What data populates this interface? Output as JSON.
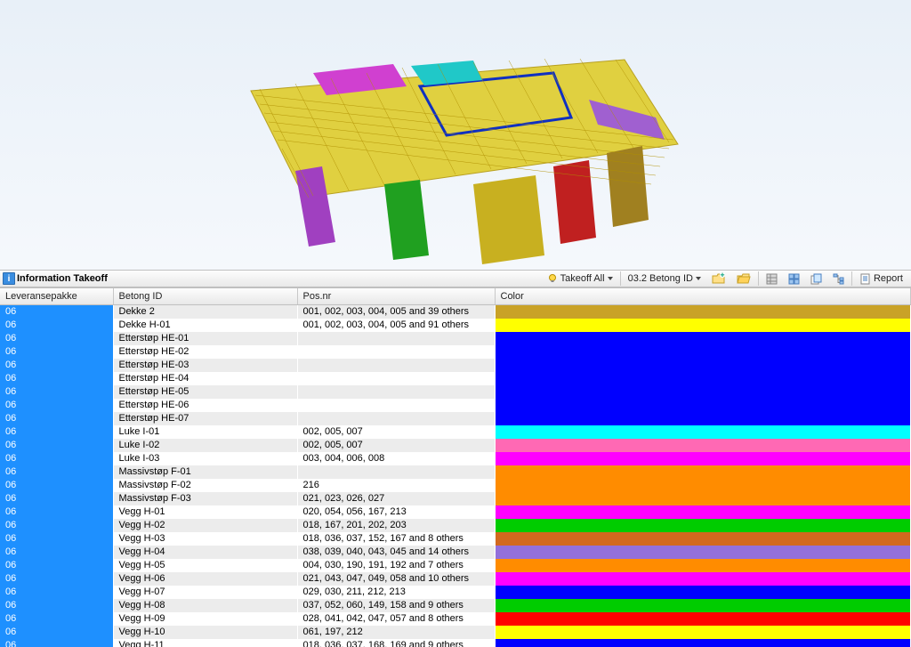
{
  "panel": {
    "title": "Information Takeoff"
  },
  "toolbar": {
    "takeoff_label": "Takeoff All",
    "preset_label": "03.2 Betong ID",
    "report_label": "Report"
  },
  "columns": {
    "c0": "Leveransepakke",
    "c1": "Betong ID",
    "c2": "Pos.nr",
    "c3": "Color"
  },
  "rows": [
    {
      "lp": "06",
      "bid": "Dekke 2",
      "pos": "001, 002, 003, 004, 005 and 39 others",
      "color": "#c9a227"
    },
    {
      "lp": "06",
      "bid": "Dekke H-01",
      "pos": "001, 002, 003, 004, 005 and 91 others",
      "color": "#ffff00"
    },
    {
      "lp": "06",
      "bid": "Etterstøp HE-01",
      "pos": "",
      "color": "#0000ff"
    },
    {
      "lp": "06",
      "bid": "Etterstøp HE-02",
      "pos": "",
      "color": "#0000ff"
    },
    {
      "lp": "06",
      "bid": "Etterstøp HE-03",
      "pos": "",
      "color": "#0000ff"
    },
    {
      "lp": "06",
      "bid": "Etterstøp HE-04",
      "pos": "",
      "color": "#0000ff"
    },
    {
      "lp": "06",
      "bid": "Etterstøp HE-05",
      "pos": "",
      "color": "#0000ff"
    },
    {
      "lp": "06",
      "bid": "Etterstøp HE-06",
      "pos": "",
      "color": "#0000ff"
    },
    {
      "lp": "06",
      "bid": "Etterstøp HE-07",
      "pos": "",
      "color": "#0000ff"
    },
    {
      "lp": "06",
      "bid": "Luke I-01",
      "pos": "002, 005, 007",
      "color": "#00ffff"
    },
    {
      "lp": "06",
      "bid": "Luke I-02",
      "pos": "002, 005, 007",
      "color": "#ff69b4"
    },
    {
      "lp": "06",
      "bid": "Luke I-03",
      "pos": "003, 004, 006, 008",
      "color": "#ff00ff"
    },
    {
      "lp": "06",
      "bid": "Massivstøp F-01",
      "pos": "",
      "color": "#ff8c00"
    },
    {
      "lp": "06",
      "bid": "Massivstøp F-02",
      "pos": "216",
      "color": "#ff8c00"
    },
    {
      "lp": "06",
      "bid": "Massivstøp F-03",
      "pos": "021, 023, 026, 027",
      "color": "#ff8c00"
    },
    {
      "lp": "06",
      "bid": "Vegg H-01",
      "pos": "020, 054, 056, 167, 213",
      "color": "#ff00ff"
    },
    {
      "lp": "06",
      "bid": "Vegg H-02",
      "pos": "018, 167, 201, 202, 203",
      "color": "#00cc00"
    },
    {
      "lp": "06",
      "bid": "Vegg H-03",
      "pos": "018, 036, 037, 152, 167 and 8 others",
      "color": "#d2691e"
    },
    {
      "lp": "06",
      "bid": "Vegg H-04",
      "pos": "038, 039, 040, 043, 045 and 14 others",
      "color": "#9370db"
    },
    {
      "lp": "06",
      "bid": "Vegg H-05",
      "pos": "004, 030, 190, 191, 192 and 7 others",
      "color": "#ff8c00"
    },
    {
      "lp": "06",
      "bid": "Vegg H-06",
      "pos": "021, 043, 047, 049, 058 and 10 others",
      "color": "#ff00ff"
    },
    {
      "lp": "06",
      "bid": "Vegg H-07",
      "pos": "029, 030, 211, 212, 213",
      "color": "#0000ff"
    },
    {
      "lp": "06",
      "bid": "Vegg H-08",
      "pos": "037, 052, 060, 149, 158 and 9 others",
      "color": "#00cc00"
    },
    {
      "lp": "06",
      "bid": "Vegg H-09",
      "pos": "028, 041, 042, 047, 057 and 8 others",
      "color": "#ff0000"
    },
    {
      "lp": "06",
      "bid": "Vegg H-10",
      "pos": "061, 197, 212",
      "color": "#ffff00"
    },
    {
      "lp": "06",
      "bid": "Vegg H-11",
      "pos": "018, 036, 037, 168, 169 and 9 others",
      "color": "#0000ff"
    }
  ]
}
